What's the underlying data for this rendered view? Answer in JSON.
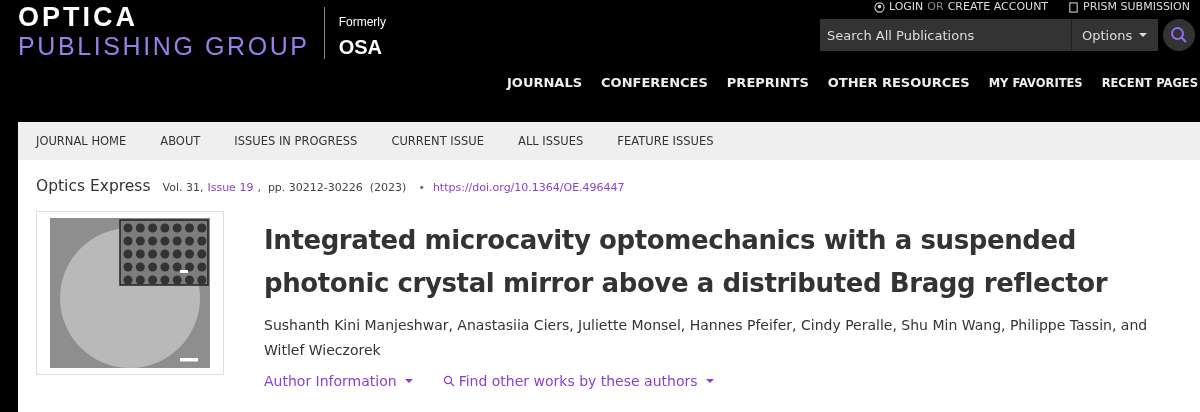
{
  "logo": {
    "line1": "OPTICA",
    "line2": "PUBLISHING GROUP",
    "formerly": "Formerly",
    "osa": "OSA"
  },
  "account_links": [
    {
      "kind": "login",
      "label": "LOGIN"
    },
    {
      "kind": "or",
      "label": "OR"
    },
    {
      "kind": "create",
      "label": "CREATE ACCOUNT"
    },
    {
      "kind": "prism",
      "label": "PRISM SUBMISSION"
    }
  ],
  "search": {
    "placeholder": "Search All Publications",
    "options": "Options"
  },
  "main_nav": [
    {
      "label": "JOURNALS",
      "kind": "primary"
    },
    {
      "label": "CONFERENCES",
      "kind": "primary"
    },
    {
      "label": "PREPRINTS",
      "kind": "primary"
    },
    {
      "label": "OTHER RESOURCES",
      "kind": "primary"
    },
    {
      "label": "MY FAVORITES",
      "kind": "secondary"
    },
    {
      "label": "RECENT PAGES",
      "kind": "secondary"
    }
  ],
  "journal_nav": [
    "JOURNAL HOME",
    "ABOUT",
    "ISSUES IN PROGRESS",
    "CURRENT ISSUE",
    "ALL ISSUES",
    "FEATURE ISSUES"
  ],
  "citation": {
    "journal": "Optics Express",
    "volume": "Vol. 31,",
    "issue": "Issue 19",
    "pages": ",  pp. 30212-30226  (2023)",
    "bullet": "•",
    "doi": "https://doi.org/10.1364/OE.496447"
  },
  "article": {
    "title": "Integrated microcavity optomechanics with a suspended photonic crystal mirror above a distributed Bragg reflector",
    "authors": "Sushanth Kini Manjeshwar, Anastasiia Ciers, Juliette Monsel, Hannes Pfeifer, Cindy Peralle, Shu Min Wang, Philippe Tassin, and Witlef Wieczorek",
    "author_info": "Author Information",
    "find_works": "Find other works by these authors"
  }
}
